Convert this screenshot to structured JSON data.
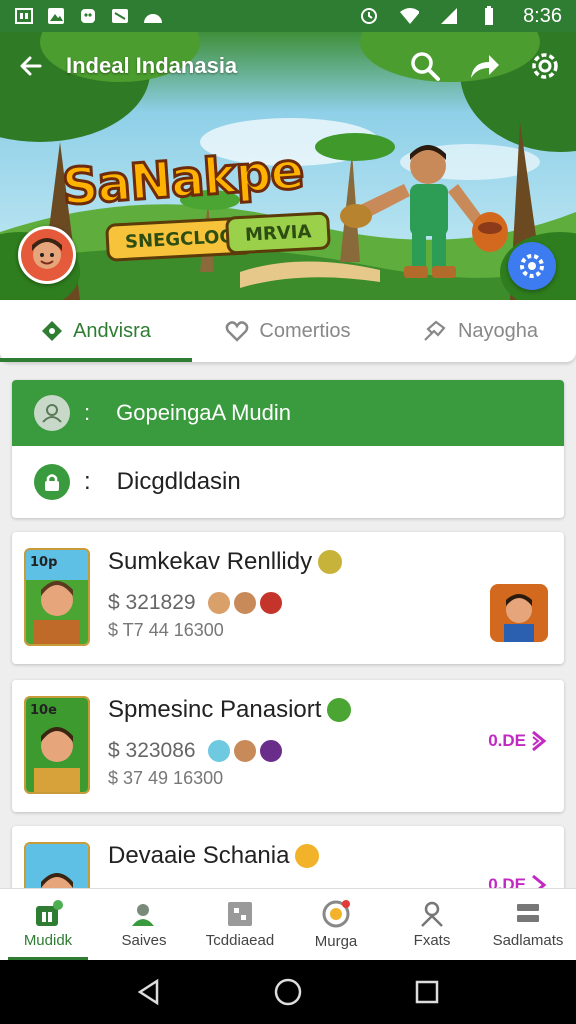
{
  "status_bar": {
    "time": "8:36"
  },
  "app_bar": {
    "title": "Indeal Indanasia"
  },
  "hero": {
    "logo_text": "SaNakpe",
    "pill_left": "SNEGCLOO",
    "pill_right": "MRVIA"
  },
  "tabs": [
    {
      "label": "Andvisra",
      "icon": "location-diamond-icon",
      "active": true
    },
    {
      "label": "Comertios",
      "icon": "heart-icon",
      "active": false
    },
    {
      "label": "Nayogha",
      "icon": "puzzle-icon",
      "active": false
    }
  ],
  "info": {
    "row1_text": "GopeingaA Mudin",
    "row1_colon": ":",
    "row2_text": "Dicgdldasin",
    "row2_colon": ":"
  },
  "cards": [
    {
      "title": "Sumkekav Renllidy",
      "price": "$ 321829",
      "sub": "$ T7 44 16300",
      "badge": "10p",
      "side": "thumb"
    },
    {
      "title": "Spmesinc Panasiort",
      "price": "$ 323086",
      "sub": "$ 37 49 16300",
      "badge": "10e",
      "side": "link",
      "side_label": "0.DE"
    },
    {
      "title": "Devaaie Schania",
      "price": "",
      "sub": "",
      "badge": "",
      "side": "link",
      "side_label": "0.DE"
    }
  ],
  "bottom_nav": [
    {
      "label": "Mudidk",
      "icon": "store-icon",
      "active": true
    },
    {
      "label": "Saives",
      "icon": "user-share-icon",
      "active": false
    },
    {
      "label": "Tcddiaead",
      "icon": "grid-box-icon",
      "active": false
    },
    {
      "label": "Murga",
      "icon": "badge-icon",
      "active": false
    },
    {
      "label": "Fxats",
      "icon": "person-icon",
      "active": false
    },
    {
      "label": "Sadlamats",
      "icon": "layers-icon",
      "active": false
    }
  ],
  "colors": {
    "primary": "#2e7d32",
    "accent": "#3a9a3e",
    "link": "#c228c2",
    "fab": "#3d7cf0"
  }
}
